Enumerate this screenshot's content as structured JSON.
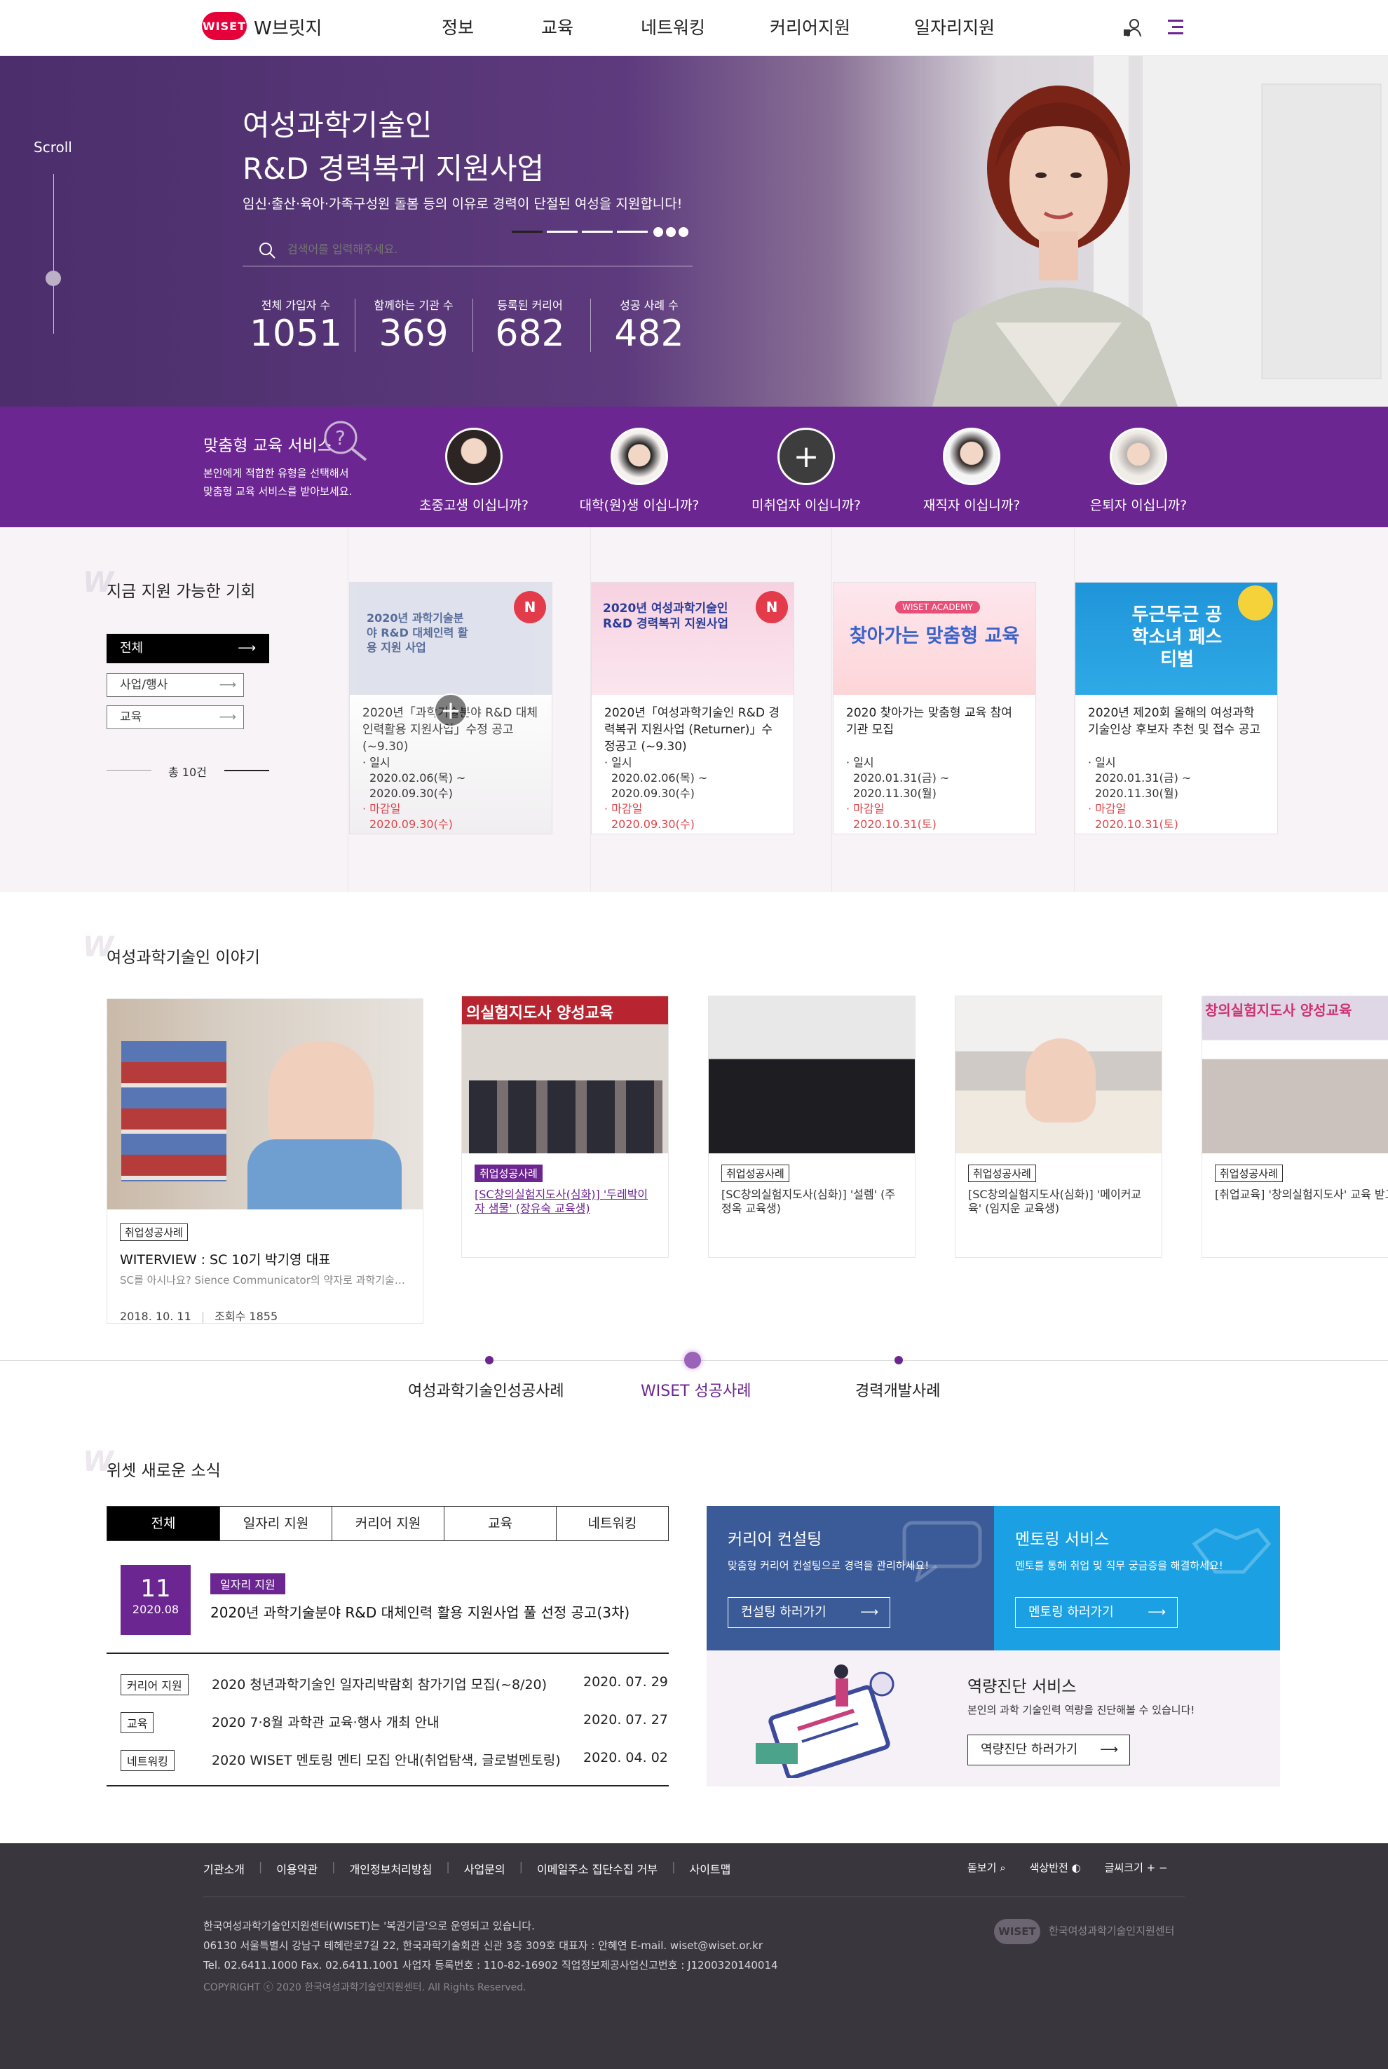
{
  "header": {
    "logo_badge": "WISET",
    "logo_name": "W브릿지",
    "nav": [
      "정보",
      "교육",
      "네트워킹",
      "커리어지원",
      "일자리지원"
    ]
  },
  "hero": {
    "scroll_label": "Scroll",
    "title_line1": "여성과학기술인",
    "title_line2": "R&D 경력복귀 지원사업",
    "subtitle": "임신·출산·육아·가족구성원 돌봄 등의 이유로 경력이 단절된 여성을 지원합니다!",
    "search_placeholder": "검색어를 입력해주세요.",
    "stats": [
      {
        "label": "전체 가입자 수",
        "value": "1051"
      },
      {
        "label": "함께하는 기관 수",
        "value": "369"
      },
      {
        "label": "등록된 커리어",
        "value": "682"
      },
      {
        "label": "성공 사례 수",
        "value": "482"
      }
    ]
  },
  "custom": {
    "title": "맞춤형 교육 서비스",
    "desc1": "본인에게 적합한 유형을 선택해서",
    "desc2": "맞춤형 교육 서비스를 받아보세요.",
    "items": [
      "초중고생 이십니까?",
      "대학(원)생 이십니까?",
      "미취업자 이십니까?",
      "재직자 이십니까?",
      "은퇴자 이십니까?"
    ]
  },
  "opp": {
    "title": "지금 지원 가능한 기회",
    "tabs": [
      "전체",
      "사업/행사",
      "교육"
    ],
    "total": "총 10건",
    "cards": [
      {
        "title": "2020년「과학기술분야 R&D 대체인력활용 지원사업」수정 공고(~9.30)",
        "date_label": "· 일시",
        "date": "2020.02.06(목) ~ 2020.09.30(수)",
        "deadline_label": "· 마감일",
        "deadline": "2020.09.30(수)",
        "badge": "N",
        "thumb_title": "2020년 과학기술분야 R&D 대체인력 활용 지원 사업"
      },
      {
        "title": "2020년「여성과학기술인 R&D 경력복귀 지원사업 (Returner)」수정공고 (~9.30)",
        "date_label": "· 일시",
        "date": "2020.02.06(목) ~ 2020.09.30(수)",
        "deadline_label": "· 마감일",
        "deadline": "2020.09.30(수)",
        "badge": "N",
        "thumb_title": "2020년 여성과학기술인 R&D 경력복귀 지원사업"
      },
      {
        "title": "2020 찾아가는 맞춤형 교육 참여기관 모집",
        "date_label": "· 일시",
        "date": "2020.01.31(금) ~ 2020.11.30(월)",
        "deadline_label": "· 마감일",
        "deadline": "2020.10.31(토)",
        "badge": "",
        "thumb_title": "찾아가는 맞춤형 교육",
        "thumb_tag": "WISET ACADEMY"
      },
      {
        "title": "2020년 제20회 올해의 여성과학기술인상 후보자 추천 및 접수 공고",
        "date_label": "· 일시",
        "date": "2020.01.31(금) ~ 2020.11.30(월)",
        "deadline_label": "· 마감일",
        "deadline": "2020.10.31(토)",
        "badge": "",
        "thumb_title": "두근두근 공학소녀 페스티벌"
      }
    ]
  },
  "stories": {
    "title": "여성과학기술인 이야기",
    "items": [
      {
        "tag": "취업성공사례",
        "title": "WITERVIEW : SC 10기 박기영 대표",
        "desc": "SC를 아시나요? Sience Communicator의 약자로 과학기술…",
        "date": "2018. 10. 11",
        "views": "조회수  1855"
      },
      {
        "tag": "취업성공사례",
        "title": "[SC창의실험지도사(심화)] '두레박이자 샘물' (장유숙 교육생)",
        "banner": "의실험지도사 양성교육"
      },
      {
        "tag": "취업성공사례",
        "title": "[SC창의실험지도사(심화)] '설렘' (주정옥 교육생)"
      },
      {
        "tag": "취업성공사례",
        "title": "[SC창의실험지도사(심화)] '메이커교육' (임지운 교육생)"
      },
      {
        "tag": "취업성공사례",
        "title": "[취업교육] '창의실험지도사' 교육 받고 취업성공",
        "banner": "창의실험지도사 양성교육"
      }
    ],
    "tabs": [
      "여성과학기술인성공사례",
      "WISET 성공사례",
      "경력개발사례"
    ]
  },
  "news": {
    "title": "위셋 새로운 소식",
    "tabs": [
      "전체",
      "일자리 지원",
      "커리어 지원",
      "교육",
      "네트워킹"
    ],
    "featured": {
      "day": "11",
      "ym": "2020.08",
      "badge": "일자리 지원",
      "title": "2020년 과학기술분야 R&D 대체인력 활용 지원사업 풀 선정 공고(3차)"
    },
    "rows": [
      {
        "badge": "커리어 지원",
        "title": "2020 청년과학기술인 일자리박람회 참가기업 모집(~8/20)",
        "date": "2020. 07. 29"
      },
      {
        "badge": "교육",
        "title": "2020 7·8월 과학관 교육·행사 개최 안내",
        "date": "2020. 07. 27"
      },
      {
        "badge": "네트워킹",
        "title": "2020 WISET 멘토링 멘티 모집 안내(취업탐색, 글로벌멘토링)",
        "date": "2020. 04. 02"
      }
    ]
  },
  "services": {
    "consult": {
      "title": "커리어 컨설팅",
      "desc": "맞춤형 커리어 컨설팅으로 경력을 관리하세요!",
      "btn": "컨설팅 하러가기"
    },
    "mentor": {
      "title": "멘토링 서비스",
      "desc": "멘토를 통해 취업 및 직무 궁금증을 해결하세요!",
      "btn": "멘토링 하러가기"
    },
    "diag": {
      "title": "역량진단 서비스",
      "desc": "본인의 과학 기술인력 역량을 진단해볼 수 있습니다!",
      "btn": "역량진단 하러가기"
    }
  },
  "footer": {
    "links": [
      "기관소개",
      "이용약관",
      "개인정보처리방침",
      "사업문의",
      "이메일주소 집단수집 거부",
      "사이트맵"
    ],
    "tools": [
      "돋보기",
      "색상반전",
      "글씨크기"
    ],
    "line1": "한국여성과학기술인지원센터(WISET)는 '복권기금'으로 운영되고 있습니다.",
    "line2": "06130 서울특별시 강남구 테헤란로7길 22, 한국과학기술회관 신관 3층 309호 대표자 : 안혜연 E-mail. wiset@wiset.or.kr",
    "line3": "Tel. 02.6411.1000   Fax. 02.6411.1001   사업자 등록번호 : 110-82-16902   직업정보제공사업신고번호 : J1200320140014",
    "copyright": "COPYRIGHT ⓒ 2020 한국여성과학기술인지원센터. All Rights Reserved.",
    "logo_badge": "WISET",
    "logo_name": "한국여성과학기술인지원센터"
  },
  "colors": {
    "purple": "#6c2692",
    "blue_dark": "#3b5a98",
    "blue_light": "#1aa0e3",
    "red": "#e0464b",
    "footer": "#3a363d"
  }
}
